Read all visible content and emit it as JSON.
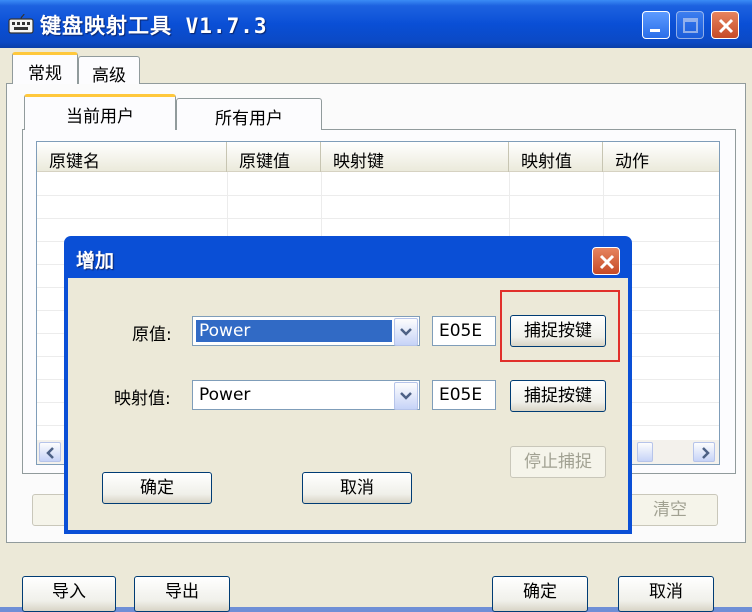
{
  "window": {
    "title": "键盘映射工具 V1.7.3"
  },
  "tabs": {
    "general": "常规",
    "advanced": "高级"
  },
  "subtabs": {
    "current_user": "当前用户",
    "all_users": "所有用户"
  },
  "list": {
    "columns": [
      "原键名",
      "原键值",
      "映射键",
      "映射值",
      "动作"
    ]
  },
  "buttons": {
    "clear": "清空",
    "import": "导入",
    "export": "导出",
    "ok": "确定",
    "cancel": "取消"
  },
  "dialog": {
    "title": "增加",
    "original_label": "原值:",
    "original_value": "Power",
    "original_code": "E05E",
    "mapped_label": "映射值:",
    "mapped_value": "Power",
    "mapped_code": "E05E",
    "capture_label": "捕捉按键",
    "stop_capture_label": "停止捕捉",
    "ok_label": "确定",
    "cancel_label": "取消"
  },
  "colors": {
    "titlebar": "#0a4fd6",
    "highlight": "#e1302b",
    "selection": "#316ac5"
  }
}
